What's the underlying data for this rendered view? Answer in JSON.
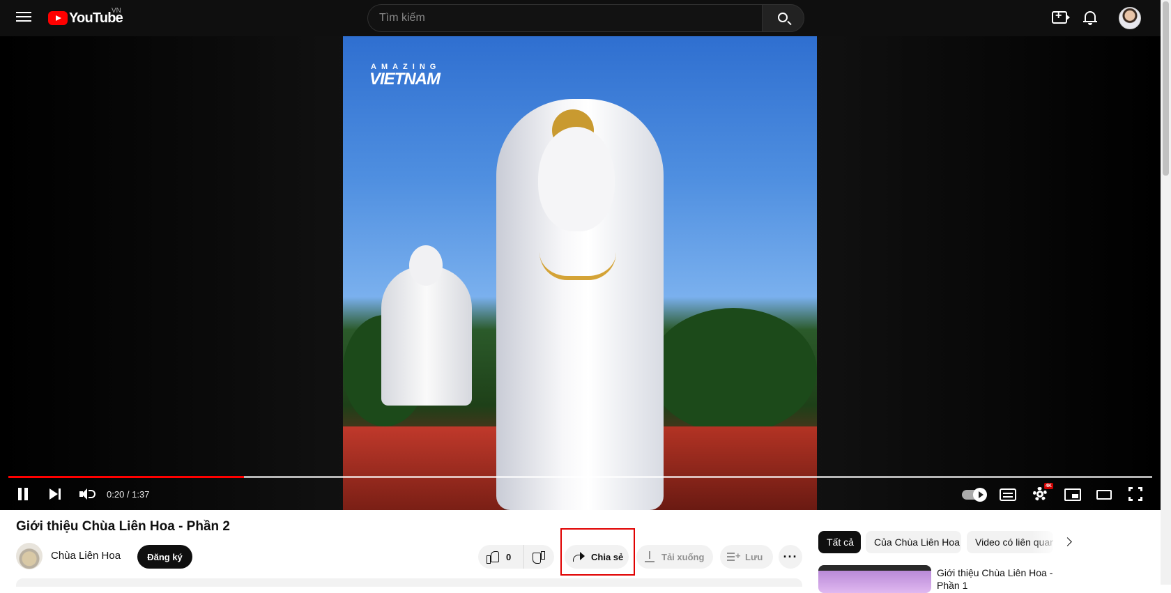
{
  "header": {
    "logo_text": "YouTube",
    "country_code": "VN",
    "search_placeholder": "Tìm kiếm"
  },
  "player": {
    "overlay_brand_top": "AMAZING",
    "overlay_brand_bottom": "VIETNAM",
    "time_display": "0:20 / 1:37",
    "progress_fraction": 0.206,
    "buffered_fraction": 1.0,
    "settings_badge": "4K"
  },
  "video": {
    "title": "Giới thiệu Chùa Liên Hoa - Phần 2",
    "channel_name": "Chùa Liên Hoa",
    "subscribe_label": "Đăng ký",
    "like_count": "0",
    "share_label": "Chia sẻ",
    "download_label": "Tải xuống",
    "save_label": "Lưu",
    "more_label": "···"
  },
  "sidebar": {
    "chips": [
      "Tất cả",
      "Của Chùa Liên Hoa",
      "Video có liên quan"
    ],
    "recommendations": [
      {
        "title": "Giới thiệu Chùa Liên Hoa - Phần 1"
      }
    ]
  },
  "colors": {
    "accent_red": "#ff0000",
    "highlight_box": "#e00000"
  }
}
